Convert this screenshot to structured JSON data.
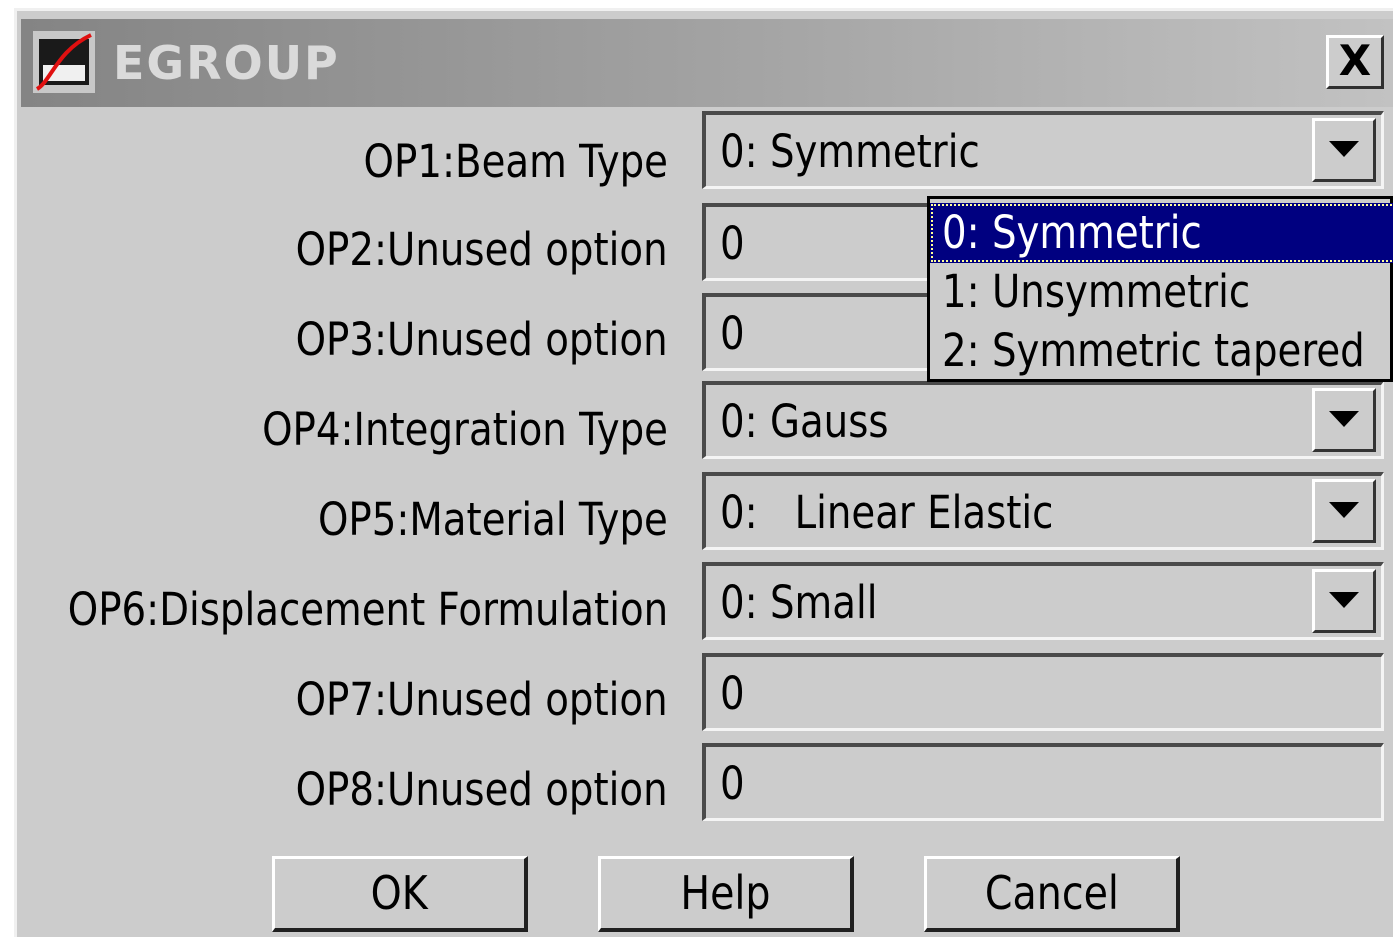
{
  "window": {
    "title": "EGROUP",
    "close_label": "X",
    "icon": "app-curve-icon"
  },
  "options": [
    {
      "label": "OP1:Beam Type",
      "value": "0: Symmetric",
      "kind": "dropdown"
    },
    {
      "label": "OP2:Unused option",
      "value": "0",
      "kind": "text"
    },
    {
      "label": "OP3:Unused option",
      "value": "0",
      "kind": "text"
    },
    {
      "label": "OP4:Integration Type",
      "value": "0: Gauss",
      "kind": "dropdown"
    },
    {
      "label": "OP5:Material Type",
      "value": "0:   Linear Elastic",
      "kind": "dropdown"
    },
    {
      "label": "OP6:Displacement Formulation",
      "value": "0: Small",
      "kind": "dropdown"
    },
    {
      "label": "OP7:Unused option",
      "value": "0",
      "kind": "text"
    },
    {
      "label": "OP8:Unused option",
      "value": "0",
      "kind": "text"
    }
  ],
  "popup": {
    "items": [
      "0: Symmetric",
      "1: Unsymmetric",
      "2: Symmetric tapered"
    ],
    "selected_index": 0
  },
  "buttons": {
    "ok": "OK",
    "help": "Help",
    "cancel": "Cancel"
  },
  "colors": {
    "dialog_bg": "#cccccc",
    "selection_bg": "#000080",
    "selection_text": "#ffffff",
    "title_text": "#dadada"
  }
}
